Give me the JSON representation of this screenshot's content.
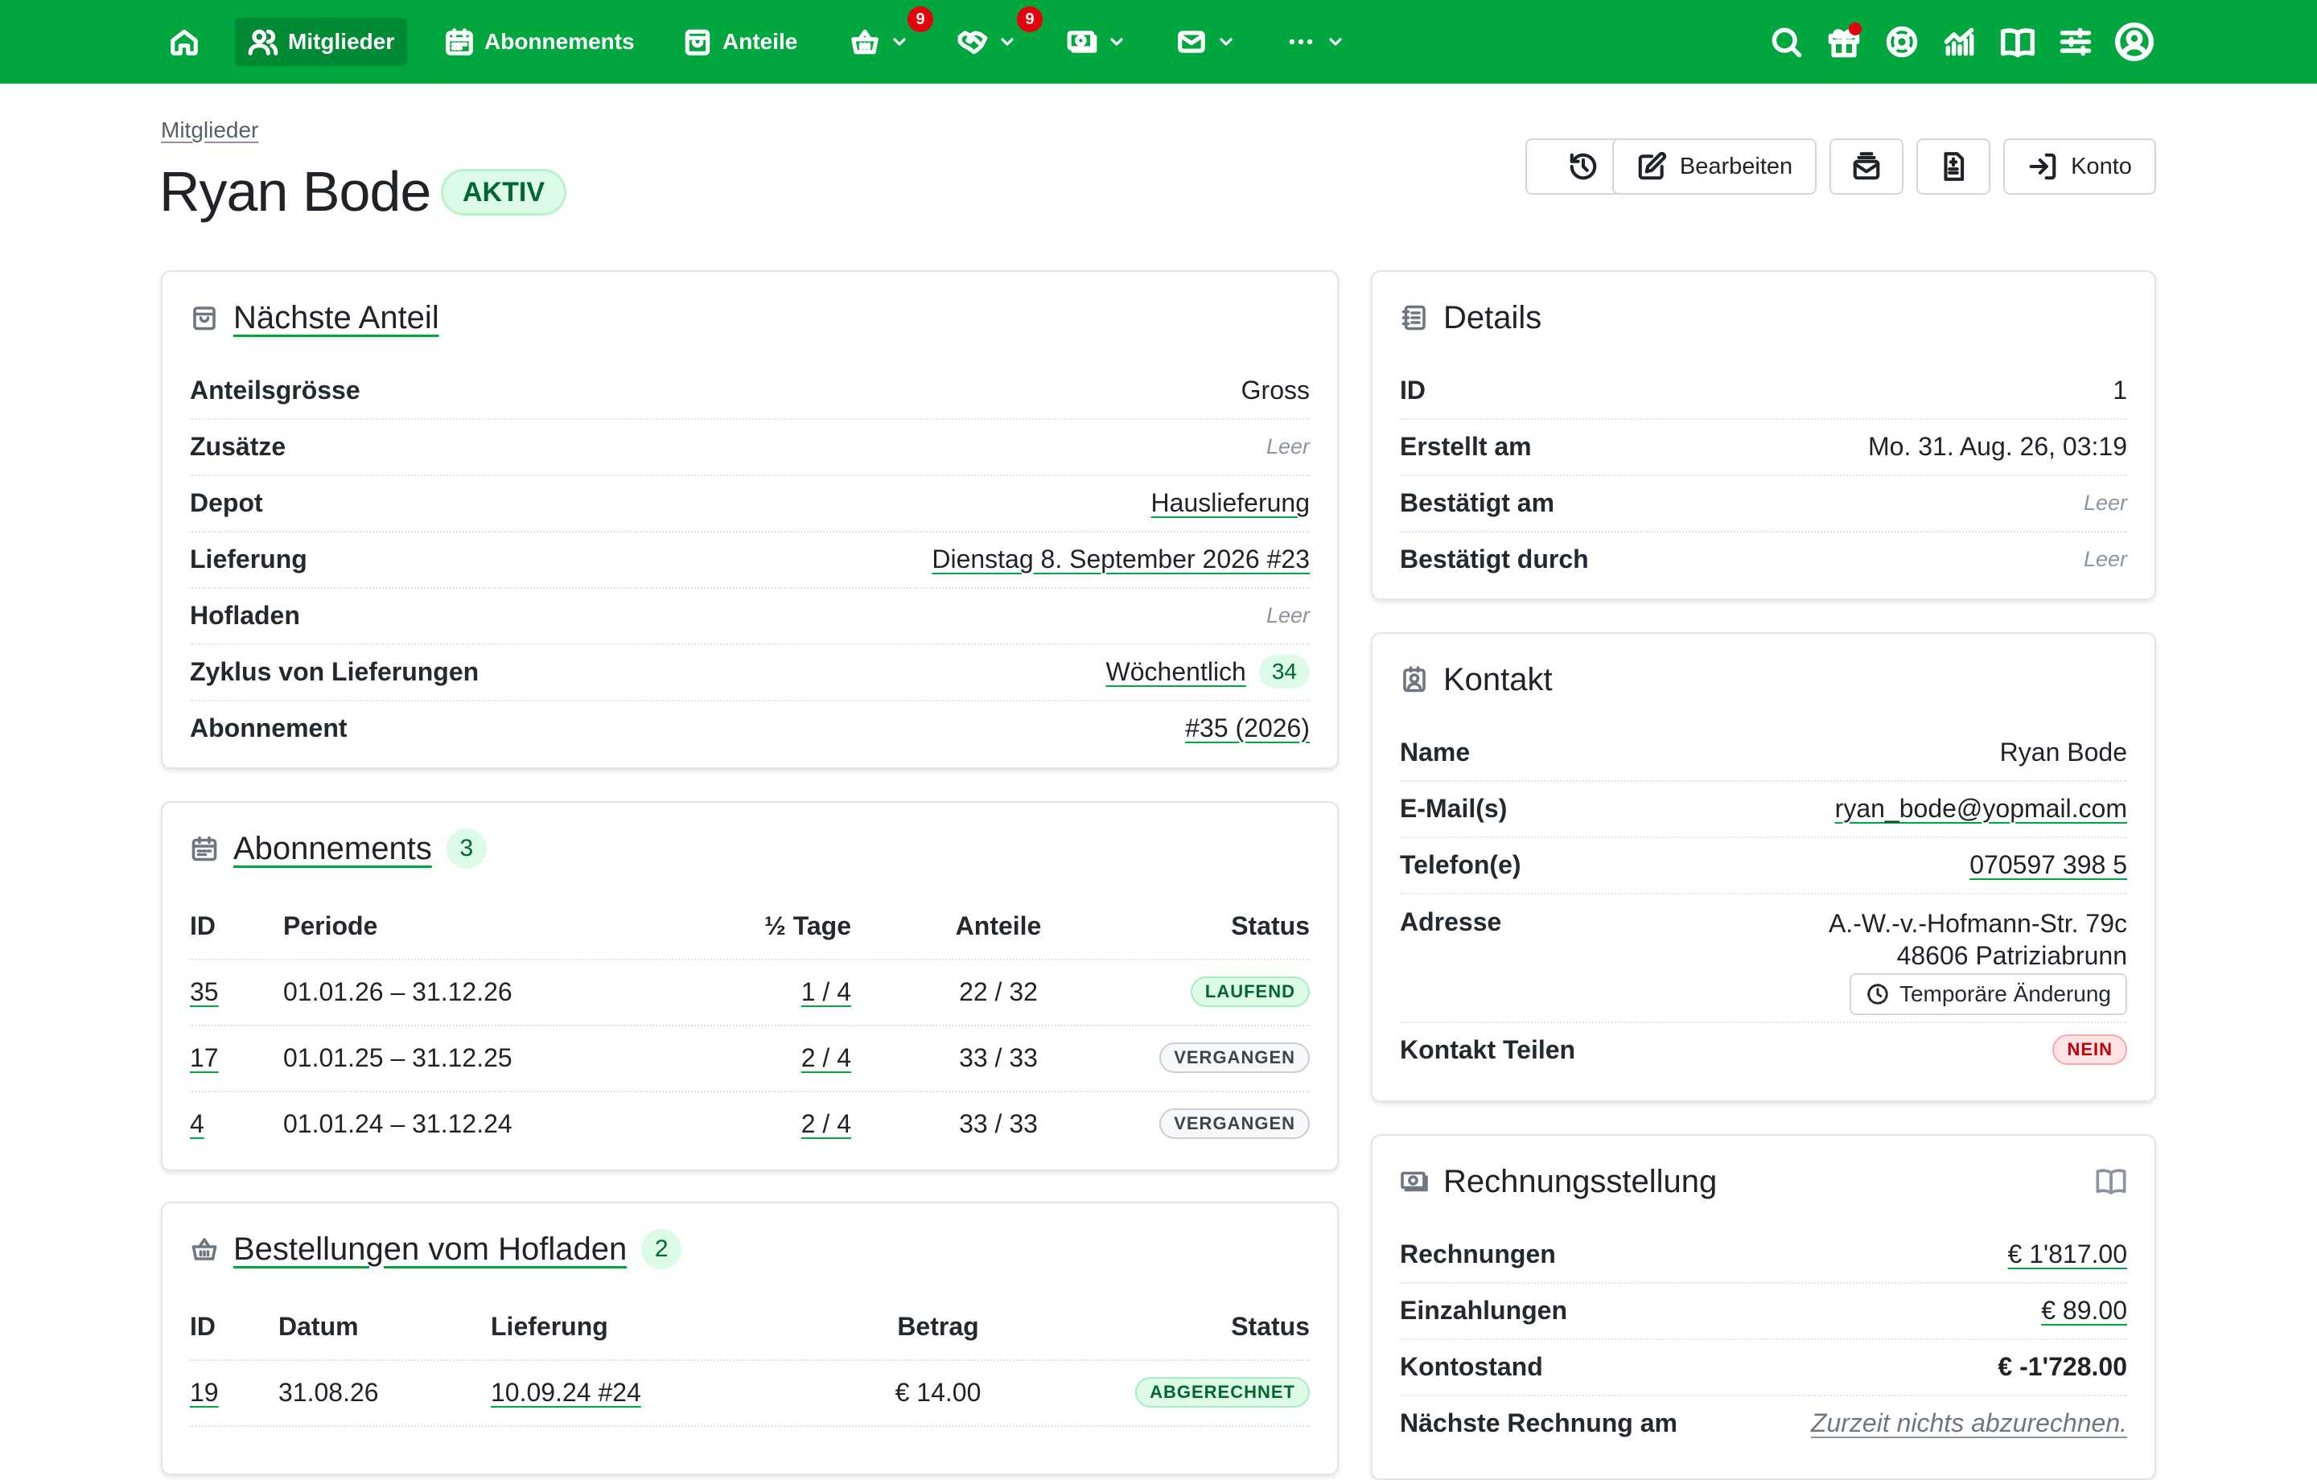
{
  "nav": {
    "members_label": "Mitglieder",
    "subscriptions_label": "Abonnements",
    "shares_label": "Anteile",
    "basket_badge": "9",
    "handshake_badge": "9"
  },
  "header": {
    "breadcrumb": "Mitglieder",
    "title": "Ryan Bode",
    "status": "AKTIV",
    "edit_label": "Bearbeiten",
    "account_label": "Konto"
  },
  "next_share": {
    "title": "Nächste Anteil",
    "rows": [
      {
        "label": "Anteilsgrösse",
        "value": "Gross"
      },
      {
        "label": "Zusätze",
        "value": "Leer"
      },
      {
        "label": "Depot",
        "value": "Hauslieferung"
      },
      {
        "label": "Lieferung",
        "value": "Dienstag 8. September 2026 #23"
      },
      {
        "label": "Hofladen",
        "value": "Leer"
      },
      {
        "label": "Zyklus von Lieferungen",
        "value": "Wöchentlich",
        "count": "34"
      },
      {
        "label": "Abonnement",
        "value": "#35 (2026)"
      }
    ]
  },
  "subscriptions": {
    "title": "Abonnements",
    "count": "3",
    "columns": {
      "id": "ID",
      "period": "Periode",
      "half_days": "½ Tage",
      "shares": "Anteile",
      "status": "Status"
    },
    "rows": [
      {
        "id": "35",
        "period": "01.01.26 – 31.12.26",
        "half_days": "1 / 4",
        "shares": "22 / 32",
        "status": "LAUFEND"
      },
      {
        "id": "17",
        "period": "01.01.25 – 31.12.25",
        "half_days": "2 / 4",
        "shares": "33 / 33",
        "status": "VERGANGEN"
      },
      {
        "id": "4",
        "period": "01.01.24 – 31.12.24",
        "half_days": "2 / 4",
        "shares": "33 / 33",
        "status": "VERGANGEN"
      }
    ]
  },
  "orders": {
    "title": "Bestellungen vom Hofladen",
    "count": "2",
    "columns": {
      "id": "ID",
      "date": "Datum",
      "delivery": "Lieferung",
      "amount": "Betrag",
      "status": "Status"
    },
    "rows": [
      {
        "id": "19",
        "date": "31.08.26",
        "delivery": "10.09.24 #24",
        "amount": "€ 14.00",
        "status": "ABGERECHNET"
      }
    ]
  },
  "details": {
    "title": "Details",
    "rows": [
      {
        "label": "ID",
        "value": "1"
      },
      {
        "label": "Erstellt am",
        "value": "Mo. 31. Aug. 26, 03:19"
      },
      {
        "label": "Bestätigt am",
        "value": "Leer"
      },
      {
        "label": "Bestätigt durch",
        "value": "Leer"
      }
    ]
  },
  "contact": {
    "title": "Kontakt",
    "name_label": "Name",
    "name": "Ryan Bode",
    "email_label": "E-Mail(s)",
    "email": "ryan_bode@yopmail.com",
    "phone_label": "Telefon(e)",
    "phone": "070597 398 5",
    "address_label": "Adresse",
    "address_line1": "A.-W.-v.-Hofmann-Str. 79c",
    "address_line2": "48606 Patriziabrunn",
    "temp_change_label": "Temporäre Änderung",
    "share_label": "Kontakt Teilen",
    "share_value": "NEIN"
  },
  "billing": {
    "title": "Rechnungsstellung",
    "invoices_label": "Rechnungen",
    "invoices": "€ 1'817.00",
    "payments_label": "Einzahlungen",
    "payments": "€ 89.00",
    "balance_label": "Kontostand",
    "balance": "€ -1'728.00",
    "next_invoice_label": "Nächste Rechnung am",
    "next_invoice": "Zurzeit nichts abzurechnen."
  }
}
